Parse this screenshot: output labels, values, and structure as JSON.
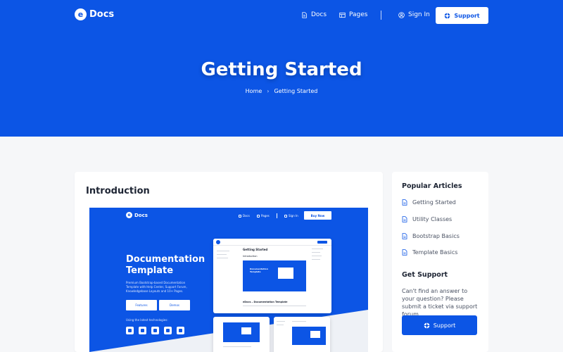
{
  "colors": {
    "brand": "#0c55e5",
    "page_bg": "#f6f7f9",
    "text": "#1d2433"
  },
  "nav": {
    "logo_mark": "e",
    "logo_text": "Docs",
    "links": [
      {
        "label": "Docs",
        "icon": "document-icon"
      },
      {
        "label": "Pages",
        "icon": "layout-icon"
      }
    ],
    "signin": {
      "label": "Sign In",
      "icon": "user-icon"
    },
    "cta": {
      "label": "Support",
      "icon": "lifebuoy-icon"
    }
  },
  "hero": {
    "title": "Getting Started",
    "breadcrumb": {
      "home": "Home",
      "separator": "›",
      "current": "Getting Started"
    }
  },
  "main": {
    "title": "Introduction",
    "preview": {
      "logo_mark": "e",
      "logo_text": "Docs",
      "links": [
        "Docs",
        "Pages",
        "Sign In"
      ],
      "cta": "Buy Now",
      "title": "Documentation Template",
      "description": "Premium Bootstrap-based Documentation Template with Help Center, Support Forum, Knowledgebase Layouts and 10+ Pages.",
      "buttons": [
        "Features",
        "Demos"
      ],
      "tech_label": "Using the latest technologies:",
      "shot_title": "Getting Started",
      "shot_subtitle": "Introduction",
      "shot_caption": "eDocs – Documentation Template",
      "shot_banner_title": "Documentation Template"
    }
  },
  "sidebar": {
    "popular_title": "Popular Articles",
    "articles": [
      "Getting Started",
      "Utility Classes",
      "Bootstrap Basics",
      "Template Basics"
    ],
    "support_title": "Get Support",
    "support_text": "Can't find an answer to your question? Please submit a ticket via support forum.",
    "support_button": "Support"
  }
}
